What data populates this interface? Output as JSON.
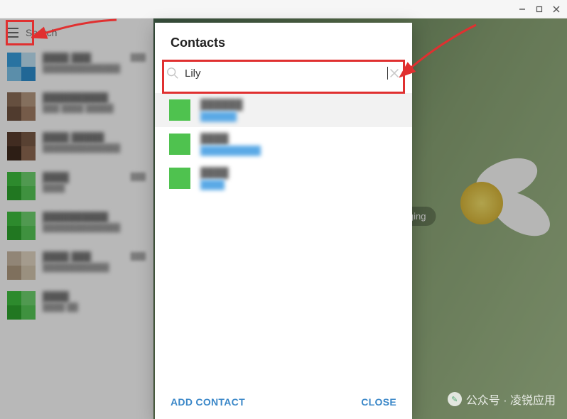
{
  "window": {
    "minimize": "–",
    "maximize": "□",
    "close": "✕"
  },
  "sidebar": {
    "search_placeholder": "Search",
    "chats": [
      {
        "name": "████ ███",
        "time": "███",
        "preview": "██████████████",
        "colors": [
          "#3aa0e0",
          "#bfe3f7",
          "#7fc5ec",
          "#2f8fd0"
        ]
      },
      {
        "name": "██████████",
        "time": "",
        "preview": "███ ████ █████",
        "colors": [
          "#8d6e58",
          "#b89a82",
          "#6f5240",
          "#a27e66"
        ]
      },
      {
        "name": "████ █████",
        "time": "",
        "preview": "██████████████",
        "colors": [
          "#5a3d2e",
          "#7a5a46",
          "#3f2a1e",
          "#8f6a52"
        ]
      },
      {
        "name": "████",
        "time": "███",
        "preview": "████",
        "colors": [
          "#3fbf3f",
          "#6fd46f",
          "#2fa52f",
          "#58c958"
        ]
      },
      {
        "name": "██████████",
        "time": "",
        "preview": "██████████████",
        "colors": [
          "#3fbf3f",
          "#6fd46f",
          "#2fa52f",
          "#58c958"
        ]
      },
      {
        "name": "████ ███",
        "time": "███",
        "preview": "████████████",
        "colors": [
          "#c9b9a4",
          "#e3d7c4",
          "#b09c82",
          "#d6c8b0"
        ]
      },
      {
        "name": "████",
        "time": "",
        "preview": "████ ██",
        "colors": [
          "#3fbf3f",
          "#6fd46f",
          "#2fa52f",
          "#58c958"
        ]
      }
    ]
  },
  "content": {
    "hint": "Select a chat to start messaging"
  },
  "dialog": {
    "title": "Contacts",
    "search_value": "Lily",
    "results": [
      {
        "name": "██████",
        "sub": "██████"
      },
      {
        "name": "████",
        "sub": "██████████"
      },
      {
        "name": "████",
        "sub": "████"
      }
    ],
    "add_contact": "ADD CONTACT",
    "close": "CLOSE"
  },
  "watermark": "公众号 · 凌锐应用"
}
